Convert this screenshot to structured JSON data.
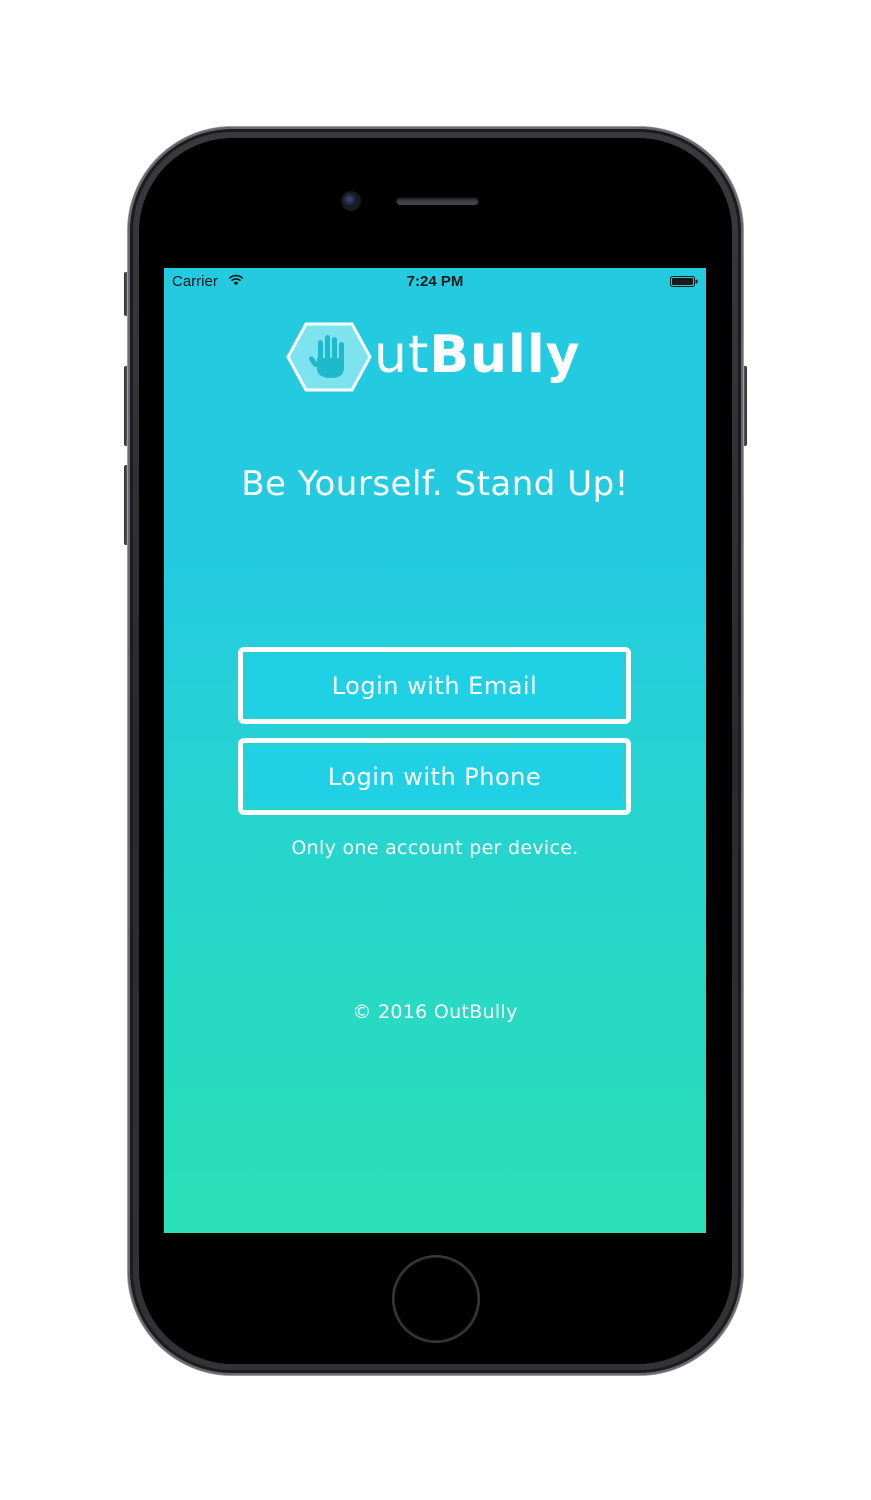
{
  "status_bar": {
    "carrier": "Carrier",
    "time": "7:24 PM",
    "wifi_icon": "wifi-icon",
    "battery_icon": "battery-icon"
  },
  "logo": {
    "badge_icon": "raised-hand-hexagon-icon",
    "text_light": "ut",
    "text_bold": "Bully"
  },
  "tagline": "Be Yourself. Stand Up!",
  "buttons": {
    "email_label": "Login with Email",
    "phone_label": "Login with Phone"
  },
  "note": "Only one account per device.",
  "copyright": "© 2016 OutBully",
  "colors": {
    "gradient_top": "#24cbe0",
    "gradient_bottom": "#2adfb6",
    "button_fill": "#20d0e4",
    "text": "#ffffff"
  }
}
